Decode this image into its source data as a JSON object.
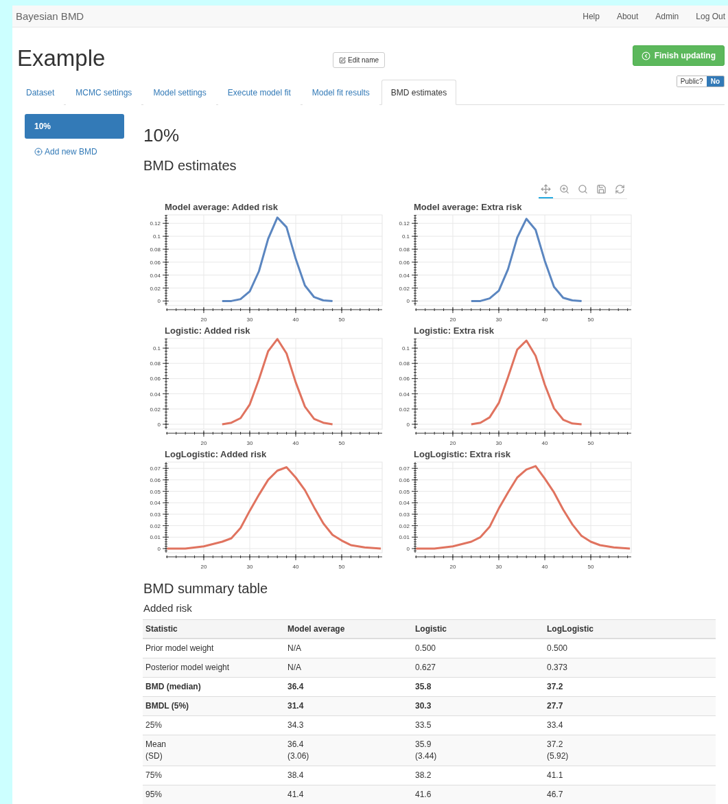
{
  "navbar": {
    "brand": "Bayesian BMD",
    "links": [
      "Help",
      "About",
      "Admin",
      "Log Out"
    ]
  },
  "header": {
    "title": "Example",
    "edit_button": "Edit name",
    "finish_button": "Finish updating",
    "public_label": "Public?",
    "public_value": "No"
  },
  "tabs": [
    {
      "label": "Dataset",
      "selected": false
    },
    {
      "label": "MCMC settings",
      "selected": false
    },
    {
      "label": "Model settings",
      "selected": false
    },
    {
      "label": "Execute model fit",
      "selected": false
    },
    {
      "label": "Model fit results",
      "selected": false
    },
    {
      "label": "BMD estimates",
      "selected": true
    }
  ],
  "sidebar": {
    "items": [
      {
        "label": "10%",
        "selected": true
      }
    ],
    "add_link": "Add new BMD"
  },
  "main": {
    "heading": "10%",
    "section_title": "BMD estimates",
    "tools": [
      {
        "kind": "pan",
        "selected": true
      },
      {
        "kind": "box_zoom",
        "selected": false
      },
      {
        "kind": "wheel_zoom",
        "selected": false
      },
      {
        "kind": "save",
        "selected": false
      },
      {
        "kind": "reset",
        "selected": false
      }
    ],
    "charts": [
      {
        "chart_data": {
          "type": "line",
          "title": "Model average: Added risk",
          "x": [
            24,
            26,
            28,
            30,
            32,
            34,
            36,
            38,
            40,
            42,
            44,
            46,
            48
          ],
          "series": [
            {
              "color": "#5b86c0",
              "values": [
                0,
                0,
                0.003,
                0.015,
                0.046,
                0.096,
                0.129,
                0.114,
                0.065,
                0.024,
                0.006,
                0.001,
                0
              ]
            }
          ],
          "grid": true,
          "xlim": [
            11.8,
            58.8
          ],
          "ylim": [
            -0.007,
            0.133
          ],
          "xticks": [
            20,
            30,
            40,
            50
          ],
          "yticks": [
            0,
            0.02,
            0.04,
            0.06,
            0.08,
            0.1,
            0.12
          ]
        }
      },
      {
        "chart_data": {
          "type": "line",
          "title": "Model average: Extra risk",
          "x": [
            24,
            26,
            28,
            30,
            32,
            34,
            36,
            38,
            40,
            42,
            44,
            46,
            48
          ],
          "series": [
            {
              "color": "#5b86c0",
              "values": [
                0,
                0,
                0.004,
                0.016,
                0.049,
                0.098,
                0.127,
                0.11,
                0.062,
                0.022,
                0.005,
                0.001,
                0
              ]
            }
          ],
          "grid": true,
          "xlim": [
            11.8,
            58.8
          ],
          "ylim": [
            -0.007,
            0.133
          ],
          "xticks": [
            20,
            30,
            40,
            50
          ],
          "yticks": [
            0,
            0.02,
            0.04,
            0.06,
            0.08,
            0.1,
            0.12
          ]
        }
      },
      {
        "chart_data": {
          "type": "line",
          "title": "Logistic: Added risk",
          "x": [
            24,
            26,
            28,
            30,
            32,
            34,
            36,
            38,
            40,
            42,
            44,
            46,
            48
          ],
          "series": [
            {
              "color": "#e0735f",
              "values": [
                0,
                0.002,
                0.008,
                0.026,
                0.059,
                0.096,
                0.112,
                0.093,
                0.055,
                0.023,
                0.007,
                0.002,
                0
              ]
            }
          ],
          "grid": true,
          "xlim": [
            11.8,
            58.8
          ],
          "ylim": [
            -0.0064,
            0.1127
          ],
          "xticks": [
            20,
            30,
            40,
            50
          ],
          "yticks": [
            0,
            0.02,
            0.04,
            0.06,
            0.08,
            0.1
          ]
        }
      },
      {
        "chart_data": {
          "type": "line",
          "title": "Logistic: Extra risk",
          "x": [
            24,
            26,
            28,
            30,
            32,
            34,
            36,
            38,
            40,
            42,
            44,
            46,
            48
          ],
          "series": [
            {
              "color": "#e0735f",
              "values": [
                0,
                0.002,
                0.009,
                0.028,
                0.062,
                0.098,
                0.11,
                0.09,
                0.052,
                0.021,
                0.006,
                0.001,
                0
              ]
            }
          ],
          "grid": true,
          "xlim": [
            11.8,
            58.8
          ],
          "ylim": [
            -0.0064,
            0.1127
          ],
          "xticks": [
            20,
            30,
            40,
            50
          ],
          "yticks": [
            0,
            0.02,
            0.04,
            0.06,
            0.08,
            0.1
          ]
        }
      },
      {
        "chart_data": {
          "type": "line",
          "title": "LogLogistic: Added risk",
          "x": [
            12,
            16,
            20,
            24,
            26,
            28,
            30,
            32,
            34,
            36,
            38,
            40,
            42,
            44,
            46,
            48,
            50,
            52,
            55,
            58.5
          ],
          "series": [
            {
              "color": "#e0735f",
              "values": [
                0,
                0,
                0.002,
                0.006,
                0.009,
                0.018,
                0.033,
                0.047,
                0.06,
                0.068,
                0.071,
                0.062,
                0.051,
                0.036,
                0.022,
                0.012,
                0.007,
                0.003,
                0.001,
                0
              ]
            }
          ],
          "grid": true,
          "xlim": [
            11.8,
            58.8
          ],
          "ylim": [
            -0.0036,
            0.0755
          ],
          "xticks": [
            20,
            30,
            40,
            50
          ],
          "yticks": [
            0,
            0.01,
            0.02,
            0.03,
            0.04,
            0.05,
            0.06,
            0.07
          ]
        }
      },
      {
        "chart_data": {
          "type": "line",
          "title": "LogLogistic: Extra risk",
          "x": [
            12,
            16,
            20,
            24,
            26,
            28,
            30,
            32,
            34,
            36,
            38,
            40,
            42,
            44,
            46,
            48,
            50,
            52,
            55,
            58.5
          ],
          "series": [
            {
              "color": "#e0735f",
              "values": [
                0,
                0,
                0.002,
                0.006,
                0.01,
                0.019,
                0.035,
                0.049,
                0.062,
                0.069,
                0.072,
                0.061,
                0.049,
                0.034,
                0.021,
                0.011,
                0.006,
                0.003,
                0.001,
                0
              ]
            }
          ],
          "grid": true,
          "xlim": [
            11.8,
            58.8
          ],
          "ylim": [
            -0.0036,
            0.0755
          ],
          "xticks": [
            20,
            30,
            40,
            50
          ],
          "yticks": [
            0,
            0.01,
            0.02,
            0.03,
            0.04,
            0.05,
            0.06,
            0.07
          ]
        }
      }
    ],
    "summary_title": "BMD summary table",
    "table_caption": "Added risk",
    "table": {
      "columns": [
        "Statistic",
        "Model average",
        "Logistic",
        "LogLogistic"
      ],
      "rows": [
        {
          "cells": [
            "Prior model weight",
            "N/A",
            "0.500",
            "0.500"
          ],
          "bold": false
        },
        {
          "cells": [
            "Posterior model weight",
            "N/A",
            "0.627",
            "0.373"
          ],
          "bold": false
        },
        {
          "cells": [
            "BMD (median)",
            "36.4",
            "35.8",
            "37.2"
          ],
          "bold": true
        },
        {
          "cells": [
            "BMDL (5%)",
            "31.4",
            "30.3",
            "27.7"
          ],
          "bold": true
        },
        {
          "cells": [
            "25%",
            "34.3",
            "33.5",
            "33.4"
          ],
          "bold": false
        },
        {
          "cells": [
            [
              "Mean",
              "(SD)"
            ],
            [
              "36.4",
              "(3.06)"
            ],
            [
              "35.9",
              "(3.44)"
            ],
            [
              "37.2",
              "(5.92)"
            ]
          ],
          "bold": false
        },
        {
          "cells": [
            "75%",
            "38.4",
            "38.2",
            "41.1"
          ],
          "bold": false
        },
        {
          "cells": [
            "95%",
            "41.4",
            "41.6",
            "46.7"
          ],
          "bold": false
        }
      ]
    }
  }
}
